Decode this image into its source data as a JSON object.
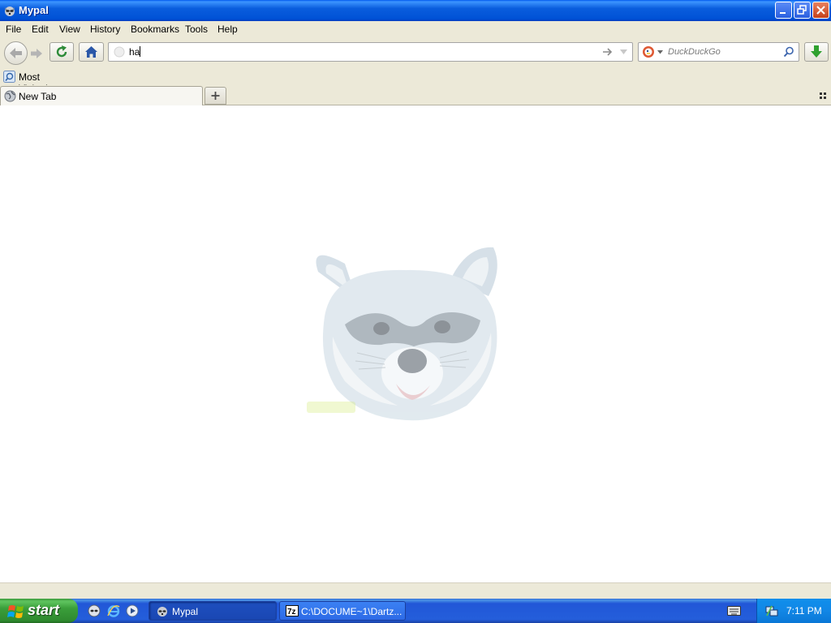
{
  "window": {
    "title": "Mypal"
  },
  "menu": {
    "items": [
      "File",
      "Edit",
      "View",
      "History",
      "Bookmarks",
      "Tools",
      "Help"
    ]
  },
  "navbar": {
    "url_value": "ha",
    "search_placeholder": "DuckDuckGo",
    "search_engine_icon": "duckduckgo-icon"
  },
  "bookmarks": {
    "most_visited_label": "Most Visited"
  },
  "tabs": {
    "items": [
      {
        "label": "New Tab",
        "icon": "globe-icon"
      }
    ]
  },
  "content": {
    "watermark_icon": "raccoon-face-logo"
  },
  "taskbar": {
    "start_label": "start",
    "tasks": [
      {
        "label": "Mypal",
        "icon": "raccoon-icon",
        "active": true
      },
      {
        "label": "C:\\DOCUME~1\\Dartz...",
        "icon": "7zip-icon",
        "active": false
      }
    ],
    "quicklaunch_icons": [
      "mypal-browser-icon",
      "internet-explorer-icon",
      "media-player-icon"
    ],
    "clock": "7:11 PM"
  },
  "colors": {
    "title_blue": "#0a5ddd",
    "chrome_beige": "#ece9d8",
    "taskbar_blue": "#245edb",
    "start_green": "#3a9e3a",
    "download_green": "#2fa12f",
    "close_red": "#c6421b"
  }
}
